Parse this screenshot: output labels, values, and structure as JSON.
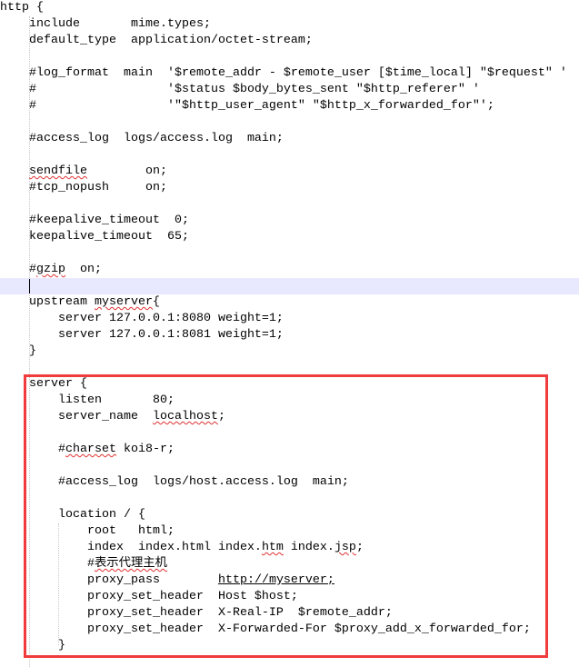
{
  "editor": {
    "current_line": 17,
    "highlight_color": "#f03c3c",
    "lines": [
      [
        [
          "http {"
        ]
      ],
      [
        [
          "    include       mime.types;"
        ]
      ],
      [
        [
          "    default_type  application/octet-stream;"
        ]
      ],
      [
        [
          ""
        ]
      ],
      [
        [
          "    #log_format  main  '$remote_addr - $remote_user [$time_local] \"$request\" '"
        ]
      ],
      [
        [
          "    #                  '$status $body_bytes_sent \"$http_referer\" '"
        ]
      ],
      [
        [
          "    #                  '\"$http_user_agent\" \"$http_x_forwarded_for\"';"
        ]
      ],
      [
        [
          ""
        ]
      ],
      [
        [
          "    #access_log  logs/access.log  main;"
        ]
      ],
      [
        [
          ""
        ]
      ],
      [
        [
          "    "
        ],
        [
          "sendfile",
          "spell"
        ],
        [
          "        on;"
        ]
      ],
      [
        [
          "    #tcp_nopush     on;"
        ]
      ],
      [
        [
          ""
        ]
      ],
      [
        [
          "    #keepalive_timeout  0;"
        ]
      ],
      [
        [
          "    keepalive_timeout  65;"
        ]
      ],
      [
        [
          ""
        ]
      ],
      [
        [
          "    #"
        ],
        [
          "gzip",
          "spell"
        ],
        [
          "  on;"
        ]
      ],
      [
        [
          ""
        ]
      ],
      [
        [
          "    upstream "
        ],
        [
          "myserver",
          "spell"
        ],
        [
          "{"
        ]
      ],
      [
        [
          "        server 127.0.0.1:8080 weight=1;"
        ]
      ],
      [
        [
          "        server 127.0.0.1:8081 weight=1;"
        ]
      ],
      [
        [
          "    }"
        ]
      ],
      [
        [
          ""
        ]
      ],
      [
        [
          "    server {"
        ]
      ],
      [
        [
          "        listen       80;"
        ]
      ],
      [
        [
          "        server_name  "
        ],
        [
          "localhost",
          "spell"
        ],
        [
          ";"
        ]
      ],
      [
        [
          ""
        ]
      ],
      [
        [
          "        #"
        ],
        [
          "charset",
          "spell"
        ],
        [
          " koi8-r;"
        ]
      ],
      [
        [
          ""
        ]
      ],
      [
        [
          "        #access_log  logs/host.access.log  main;"
        ]
      ],
      [
        [
          ""
        ]
      ],
      [
        [
          "        location / {"
        ]
      ],
      [
        [
          "            root   html;"
        ]
      ],
      [
        [
          "            index  index.html index."
        ],
        [
          "htm",
          "spell"
        ],
        [
          " index."
        ],
        [
          "jsp",
          "spell"
        ],
        [
          ";"
        ]
      ],
      [
        [
          "            #"
        ],
        [
          "表示代理主机",
          "spell"
        ]
      ],
      [
        [
          "            proxy_pass        "
        ],
        [
          "http://myserver;",
          "link"
        ]
      ],
      [
        [
          "            proxy_set_header  Host $host;"
        ]
      ],
      [
        [
          "            proxy_set_header  X-Real-IP  $remote_addr;"
        ]
      ],
      [
        [
          "            proxy_set_header  X-Forwarded-For $proxy_add_x_forwarded_for;"
        ]
      ],
      [
        [
          "        }"
        ]
      ]
    ]
  }
}
